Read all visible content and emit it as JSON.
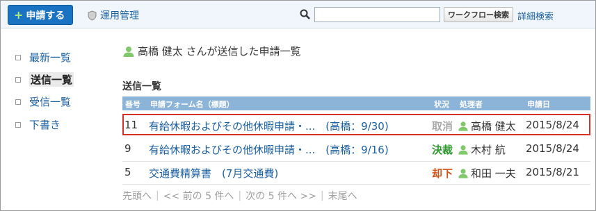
{
  "toolbar": {
    "apply_label": "申請する",
    "admin_label": "運用管理",
    "search_placeholder": "",
    "workflow_search_label": "ワークフロー検索",
    "advanced_search_label": "詳細検索"
  },
  "sidebar": {
    "items": [
      {
        "label": "最新一覧",
        "current": false
      },
      {
        "label": "送信一覧",
        "current": true
      },
      {
        "label": "受信一覧",
        "current": false
      },
      {
        "label": "下書き",
        "current": false
      }
    ]
  },
  "main": {
    "heading": "高橋 健太 さんが送信した申請一覧",
    "section_title": "送信一覧",
    "columns": {
      "number": "番号",
      "form_name": "申請フォーム名（標題）",
      "status": "状況",
      "handler": "処理者",
      "date": "申請日"
    },
    "rows": [
      {
        "number": "11",
        "subject": "有給休暇およびその他休暇申請・...　(高橋：9/30)",
        "status": "取消",
        "handler": "高橋 健太",
        "date": "2015/8/24"
      },
      {
        "number": "9",
        "subject": "有給休暇およびその他休暇申請・...　(高橋：9/16)",
        "status": "決裁",
        "handler": "木村 航",
        "date": "2015/8/24"
      },
      {
        "number": "5",
        "subject": "交通費精算書　(7月交通費)",
        "status": "却下",
        "handler": "和田 一夫",
        "date": "2015/8/21"
      }
    ],
    "pager": {
      "first": "先頭へ",
      "prev": "<< 前の 5 件へ",
      "next": "次の 5 件へ >>",
      "last": "末尾へ"
    }
  },
  "colors": {
    "accent": "#1a73c2",
    "link": "#1a5fa0",
    "table_header": "#8cb4d8",
    "selected_border": "#d93025"
  }
}
